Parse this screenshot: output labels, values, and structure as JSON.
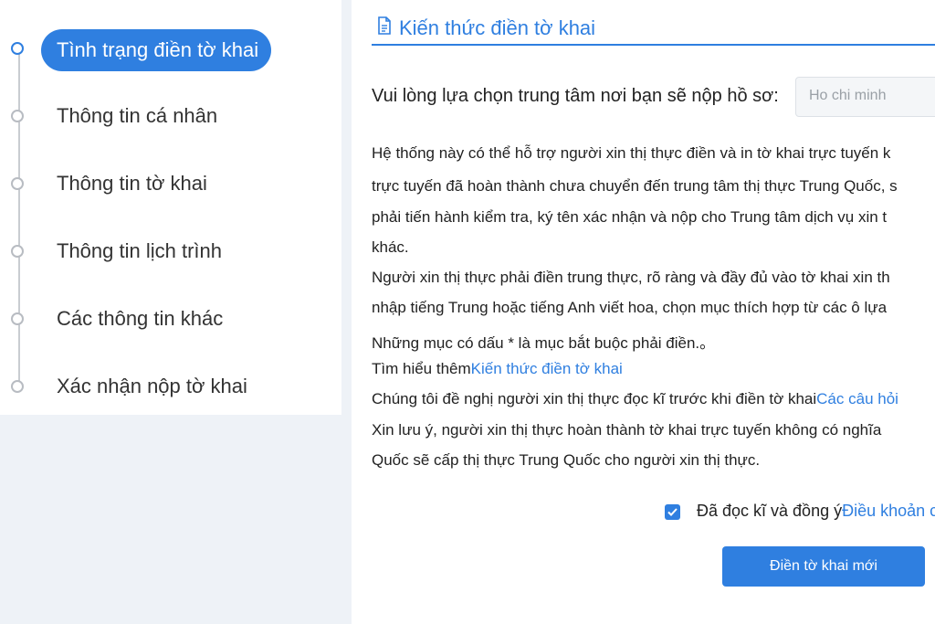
{
  "steps": [
    {
      "label": "Tình trạng điền tờ khai",
      "active": true
    },
    {
      "label": "Thông tin cá nhân",
      "active": false
    },
    {
      "label": "Thông tin tờ khai",
      "active": false
    },
    {
      "label": "Thông tin lịch trình",
      "active": false
    },
    {
      "label": "Các thông tin khác",
      "active": false
    },
    {
      "label": "Xác nhận nộp tờ khai",
      "active": false
    }
  ],
  "section": {
    "title": "Kiến thức điền tờ khai",
    "icon": "document-icon"
  },
  "center": {
    "label": "Vui lòng lựa chọn trung tâm nơi bạn sẽ nộp hồ sơ:",
    "selected": "Ho chi minh"
  },
  "paragraphs": [
    {
      "text": "Hệ thống này có thể hỗ trợ người xin thị thực điền và in tờ khai trực tuyến k"
    },
    {
      "text": "trực tuyến đã hoàn thành chưa chuyển đến trung tâm thị thực Trung Quốc, s"
    },
    {
      "text": "phải tiến hành kiểm tra, ký tên xác nhận và nộp cho Trung tâm dịch vụ xin t"
    },
    {
      "text": "khác."
    },
    {
      "text": "Người xin thị thực phải điền trung thực, rõ ràng và đầy đủ vào tờ khai xin th"
    },
    {
      "text": "nhập tiếng Trung hoặc tiếng Anh viết hoa, chọn mục thích hợp từ các ô lựa"
    },
    {
      "text": "Những mục có dấu * là mục bắt buộc phải điền.。"
    },
    {
      "prefix": "Tìm hiểu thêm",
      "link": "Kiến thức điền tờ khai"
    },
    {
      "prefix": "Chúng tôi đề nghị người xin thị thực đọc kĩ trước khi điền tờ khai",
      "link": "Các câu hỏi"
    },
    {
      "text": "Xin lưu ý, người xin thị thực hoàn thành tờ khai trực tuyến không có nghĩa"
    },
    {
      "text": "Quốc sẽ cấp thị thực Trung Quốc cho người xin thị thực."
    }
  ],
  "agree": {
    "prefix": "Đã đọc kĩ và đồng ý",
    "link": "Điều khoản c",
    "checked": true
  },
  "button": {
    "label": "Điền tờ khai mới"
  },
  "colors": {
    "accent": "#2f7fe0",
    "sidebar_bg": "#ffffff",
    "page_bg": "#eef2f7"
  }
}
